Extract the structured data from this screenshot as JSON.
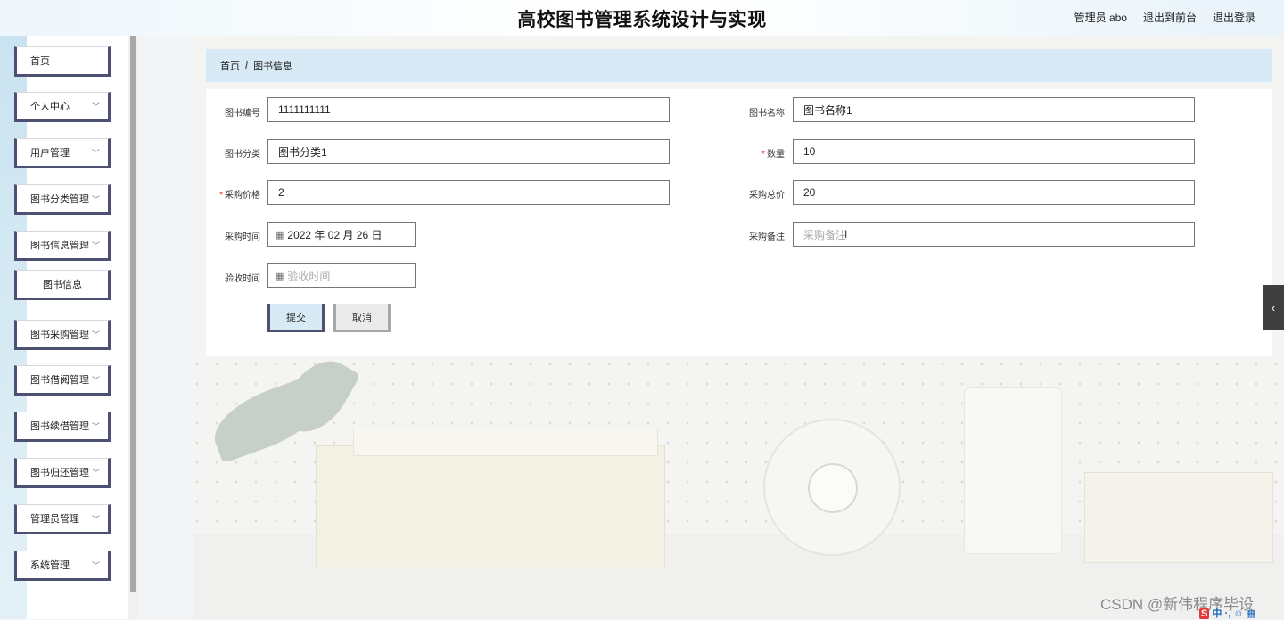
{
  "header": {
    "title": "高校图书管理系统设计与实现",
    "admin_label": "管理员 abo",
    "front_link": "退出到前台",
    "logout_link": "退出登录"
  },
  "sidebar": {
    "items": [
      {
        "label": "首页",
        "expandable": false
      },
      {
        "label": "个人中心",
        "expandable": true
      },
      {
        "label": "用户管理",
        "expandable": true
      },
      {
        "label": "图书分类管理",
        "expandable": true
      },
      {
        "label": "图书信息管理",
        "expandable": true
      },
      {
        "label": "图书信息",
        "expandable": false,
        "sub": true
      },
      {
        "label": "图书采购管理",
        "expandable": true
      },
      {
        "label": "图书借阅管理",
        "expandable": true
      },
      {
        "label": "图书续借管理",
        "expandable": true
      },
      {
        "label": "图书归还管理",
        "expandable": true
      },
      {
        "label": "管理员管理",
        "expandable": true
      },
      {
        "label": "系统管理",
        "expandable": true
      }
    ]
  },
  "breadcrumb": {
    "home": "首页",
    "separator": "/",
    "current": "图书信息"
  },
  "form": {
    "book_no": {
      "label": "图书编号",
      "value": "1111111111"
    },
    "book_name": {
      "label": "图书名称",
      "value": "图书名称1"
    },
    "category": {
      "label": "图书分类",
      "value": "图书分类1"
    },
    "quantity": {
      "label": "数量",
      "required": true,
      "value": "10"
    },
    "price": {
      "label": "采购价格",
      "required": true,
      "value": "2"
    },
    "total": {
      "label": "采购总价",
      "value": "20"
    },
    "purchase_time": {
      "label": "采购时间",
      "value": "2022 年 02 月 26 日"
    },
    "note": {
      "label": "采购备注",
      "placeholder": "采购备注"
    },
    "check_time": {
      "label": "验收时间",
      "placeholder": "验收时间"
    },
    "submit_label": "提交",
    "cancel_label": "取消",
    "required_mark": "*"
  },
  "watermark": "CSDN @新伟程序毕设",
  "ime": {
    "s": "S",
    "text": "中 ·, ☺ ▦"
  },
  "icons": {
    "chevron": "chevron-down-icon",
    "calendar": "calendar-icon",
    "collapse": "chevron-left-icon"
  }
}
